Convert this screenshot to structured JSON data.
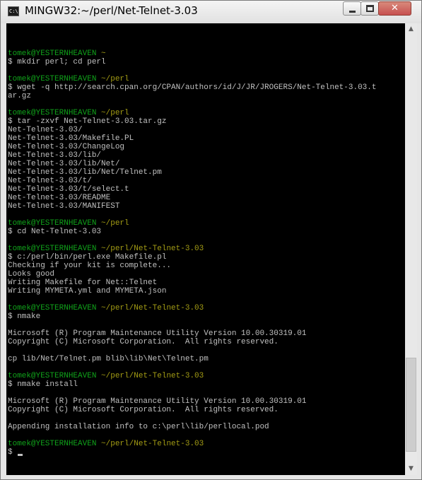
{
  "window": {
    "title": "MINGW32:~/perl/Net-Telnet-3.03",
    "icon_text": "C:\\",
    "controls": {
      "close_glyph": "✕",
      "scroll_up": "▲",
      "scroll_down": "▼"
    }
  },
  "colors": {
    "background": "#000000",
    "text": "#c0c0c0",
    "prompt_user": "#10a21a",
    "prompt_path": "#a39c14"
  },
  "terminal": {
    "lines": [
      {
        "type": "blank"
      },
      {
        "type": "blank"
      },
      {
        "type": "blank"
      },
      {
        "type": "prompt",
        "user": "tomek@YESTERNHEAVEN",
        "path": "~"
      },
      {
        "type": "text",
        "text": "$ mkdir perl; cd perl"
      },
      {
        "type": "blank"
      },
      {
        "type": "prompt",
        "user": "tomek@YESTERNHEAVEN",
        "path": "~/perl"
      },
      {
        "type": "text",
        "text": "$ wget -q http://search.cpan.org/CPAN/authors/id/J/JR/JROGERS/Net-Telnet-3.03.t"
      },
      {
        "type": "text",
        "text": "ar.gz"
      },
      {
        "type": "blank"
      },
      {
        "type": "prompt",
        "user": "tomek@YESTERNHEAVEN",
        "path": "~/perl"
      },
      {
        "type": "text",
        "text": "$ tar -zxvf Net-Telnet-3.03.tar.gz"
      },
      {
        "type": "text",
        "text": "Net-Telnet-3.03/"
      },
      {
        "type": "text",
        "text": "Net-Telnet-3.03/Makefile.PL"
      },
      {
        "type": "text",
        "text": "Net-Telnet-3.03/ChangeLog"
      },
      {
        "type": "text",
        "text": "Net-Telnet-3.03/lib/"
      },
      {
        "type": "text",
        "text": "Net-Telnet-3.03/lib/Net/"
      },
      {
        "type": "text",
        "text": "Net-Telnet-3.03/lib/Net/Telnet.pm"
      },
      {
        "type": "text",
        "text": "Net-Telnet-3.03/t/"
      },
      {
        "type": "text",
        "text": "Net-Telnet-3.03/t/select.t"
      },
      {
        "type": "text",
        "text": "Net-Telnet-3.03/README"
      },
      {
        "type": "text",
        "text": "Net-Telnet-3.03/MANIFEST"
      },
      {
        "type": "blank"
      },
      {
        "type": "prompt",
        "user": "tomek@YESTERNHEAVEN",
        "path": "~/perl"
      },
      {
        "type": "text",
        "text": "$ cd Net-Telnet-3.03"
      },
      {
        "type": "blank"
      },
      {
        "type": "prompt",
        "user": "tomek@YESTERNHEAVEN",
        "path": "~/perl/Net-Telnet-3.03"
      },
      {
        "type": "text",
        "text": "$ c:/perl/bin/perl.exe Makefile.pl"
      },
      {
        "type": "text",
        "text": "Checking if your kit is complete..."
      },
      {
        "type": "text",
        "text": "Looks good"
      },
      {
        "type": "text",
        "text": "Writing Makefile for Net::Telnet"
      },
      {
        "type": "text",
        "text": "Writing MYMETA.yml and MYMETA.json"
      },
      {
        "type": "blank"
      },
      {
        "type": "prompt",
        "user": "tomek@YESTERNHEAVEN",
        "path": "~/perl/Net-Telnet-3.03"
      },
      {
        "type": "text",
        "text": "$ nmake"
      },
      {
        "type": "blank"
      },
      {
        "type": "text",
        "text": "Microsoft (R) Program Maintenance Utility Version 10.00.30319.01"
      },
      {
        "type": "text",
        "text": "Copyright (C) Microsoft Corporation.  All rights reserved."
      },
      {
        "type": "blank"
      },
      {
        "type": "text",
        "text": "cp lib/Net/Telnet.pm blib\\lib\\Net\\Telnet.pm"
      },
      {
        "type": "blank"
      },
      {
        "type": "prompt",
        "user": "tomek@YESTERNHEAVEN",
        "path": "~/perl/Net-Telnet-3.03"
      },
      {
        "type": "text",
        "text": "$ nmake install"
      },
      {
        "type": "blank"
      },
      {
        "type": "text",
        "text": "Microsoft (R) Program Maintenance Utility Version 10.00.30319.01"
      },
      {
        "type": "text",
        "text": "Copyright (C) Microsoft Corporation.  All rights reserved."
      },
      {
        "type": "blank"
      },
      {
        "type": "text",
        "text": "Appending installation info to c:\\perl\\lib/perllocal.pod"
      },
      {
        "type": "blank"
      },
      {
        "type": "prompt",
        "user": "tomek@YESTERNHEAVEN",
        "path": "~/perl/Net-Telnet-3.03"
      },
      {
        "type": "cursor",
        "text": "$"
      }
    ]
  }
}
